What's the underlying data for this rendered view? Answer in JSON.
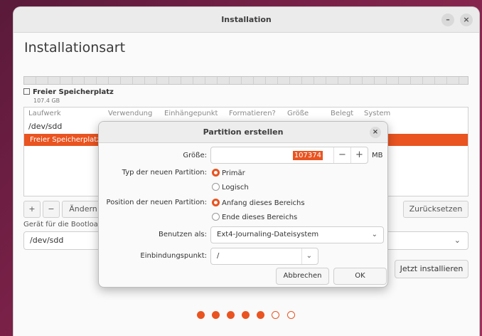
{
  "window": {
    "title": "Installation",
    "minimize": "–",
    "close": "×"
  },
  "page": {
    "heading": "Installationsart"
  },
  "partition_legend": {
    "label": "Freier Speicherplatz",
    "size": "107.4 GB"
  },
  "table": {
    "columns": [
      "Laufwerk",
      "Verwendung",
      "Einhängepunkt",
      "Formatieren?",
      "Größe",
      "Belegt",
      "System"
    ],
    "device": "/dev/sdd",
    "selected_row": "Freier Speicherplatz"
  },
  "toolbar": {
    "add": "+",
    "remove": "−",
    "change": "Ändern",
    "revert": "Zurücksetzen"
  },
  "boot": {
    "label": "Gerät für die Bootloader-Installation:",
    "value": "/dev/sdd"
  },
  "install_button": "Jetzt installieren",
  "progress": {
    "total": 7,
    "done": 5
  },
  "dialog": {
    "title": "Partition erstellen",
    "close": "×",
    "size_label": "Größe:",
    "size_value": "107374",
    "size_unit": "MB",
    "minus": "−",
    "plus": "+",
    "type_label": "Typ der neuen Partition:",
    "type_primary": "Primär",
    "type_logical": "Logisch",
    "position_label": "Position der neuen Partition:",
    "position_start": "Anfang dieses Bereichs",
    "position_end": "Ende dieses Bereichs",
    "use_as_label": "Benutzen als:",
    "use_as_value": "Ext4-Journaling-Dateisystem",
    "mount_label": "Einbindungspunkt:",
    "mount_value": "/",
    "cancel": "Abbrechen",
    "ok": "OK"
  },
  "colors": {
    "accent": "#e95420"
  }
}
